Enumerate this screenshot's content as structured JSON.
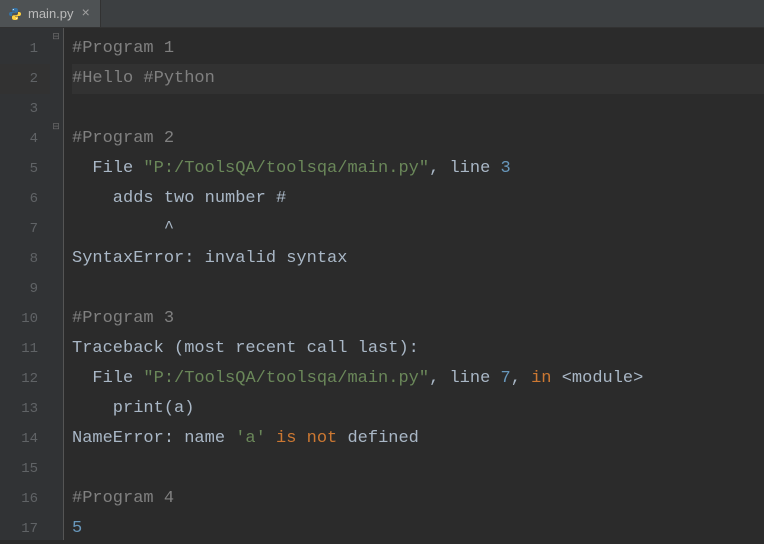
{
  "tab": {
    "filename": "main.py",
    "close": "×"
  },
  "gutter": {
    "lines": [
      "1",
      "2",
      "3",
      "4",
      "5",
      "6",
      "7",
      "8",
      "9",
      "10",
      "11",
      "12",
      "13",
      "14",
      "15",
      "16",
      "17"
    ]
  },
  "code": {
    "l1": {
      "comment": "#Program 1"
    },
    "l2": {
      "comment": "#Hello #Python"
    },
    "l3": {
      "blank": ""
    },
    "l4": {
      "comment": "#Program 2"
    },
    "l5": {
      "pre": "  File ",
      "str": "\"P:/ToolsQA/toolsqa/main.py\"",
      "mid": ", line ",
      "num": "3"
    },
    "l6": {
      "text": "    adds two number #"
    },
    "l7": {
      "text": "         ^"
    },
    "l8": {
      "text": "SyntaxError: invalid syntax"
    },
    "l9": {
      "blank": ""
    },
    "l10": {
      "comment": "#Program 3"
    },
    "l11": {
      "text": "Traceback (most recent call last):"
    },
    "l12": {
      "pre": "  File ",
      "str": "\"P:/ToolsQA/toolsqa/main.py\"",
      "mid": ", line ",
      "num": "7",
      "mid2": ", ",
      "kw": "in",
      "tail": " <module>"
    },
    "l13": {
      "text": "    print(a)"
    },
    "l14": {
      "a": "NameError: name ",
      "str": "'a'",
      "sp1": " ",
      "is": "is",
      "sp2": " ",
      "not": "not",
      "tail": " defined"
    },
    "l15": {
      "blank": ""
    },
    "l16": {
      "comment": "#Program 4"
    },
    "l17": {
      "num": "5"
    }
  }
}
